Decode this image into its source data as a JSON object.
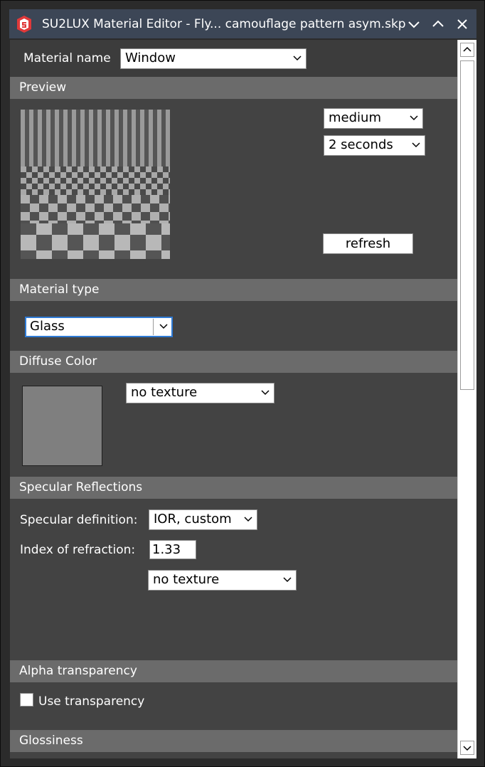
{
  "window": {
    "title": "SU2LUX Material Editor - Fly... camouflage pattern asym.skp",
    "accent": "#3c4656"
  },
  "material_name": {
    "label": "Material name",
    "value": "Window"
  },
  "preview": {
    "header": "Preview",
    "quality": "medium",
    "duration": "2 seconds",
    "refresh_label": "refresh"
  },
  "material_type": {
    "header": "Material type",
    "value": "Glass"
  },
  "diffuse": {
    "header": "Diffuse Color",
    "swatch_color": "#7f7f7f",
    "texture": "no texture"
  },
  "specular": {
    "header": "Specular Reflections",
    "definition_label": "Specular definition:",
    "definition_value": "IOR, custom",
    "ior_label": "Index of refraction:",
    "ior_value": "1.33",
    "texture": "no texture"
  },
  "alpha": {
    "header": "Alpha transparency",
    "use_label": "Use transparency"
  },
  "glossiness": {
    "header": "Glossiness"
  }
}
